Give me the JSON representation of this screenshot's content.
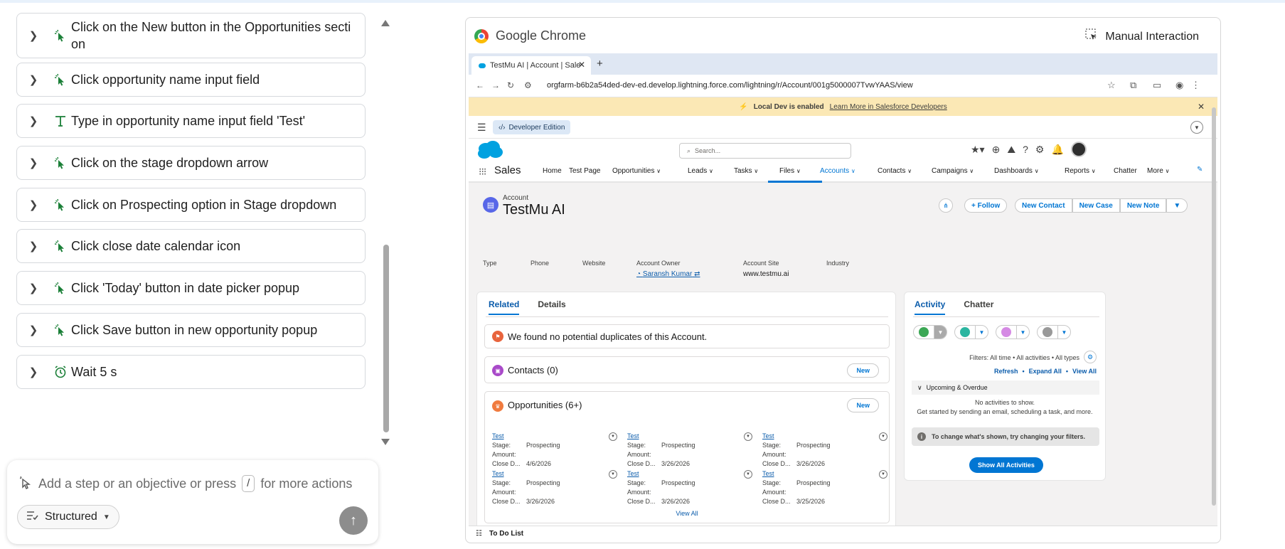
{
  "steps": [
    {
      "icon": "cursor-sparkle-icon",
      "label": "Click on the New button in the Opportunities secti\non"
    },
    {
      "icon": "cursor-sparkle-icon",
      "label": "Click opportunity name input field"
    },
    {
      "icon": "text-type-icon",
      "label": "Type in opportunity name input field 'Test'"
    },
    {
      "icon": "cursor-sparkle-icon",
      "label": "Click on the stage dropdown arrow"
    },
    {
      "icon": "cursor-sparkle-icon",
      "label": "Click on Prospecting option in Stage dropdown"
    },
    {
      "icon": "cursor-sparkle-icon",
      "label": "Click close date calendar icon"
    },
    {
      "icon": "cursor-sparkle-icon",
      "label": "Click 'Today' button in date picker popup"
    },
    {
      "icon": "cursor-sparkle-icon",
      "label": "Click Save button in new opportunity popup"
    },
    {
      "icon": "alarm-clock-icon",
      "label": "Wait 5 s"
    }
  ],
  "composer": {
    "placeholder_pre": "Add a step or an objective or press",
    "kbd": "/",
    "placeholder_post": "for more actions",
    "mode": "Structured"
  },
  "browser": {
    "app": "Google Chrome",
    "manual": "Manual Interaction",
    "tab_title": "TestMu AI | Account | Sale",
    "url": "orgfarm-b6b2a54ded-dev-ed.develop.lightning.force.com/lightning/r/Account/001g5000007TvwYAAS/view"
  },
  "sf": {
    "banner_text": "Local Dev is enabled",
    "banner_link": "Learn More in Salesforce Developers",
    "edition": "Developer Edition",
    "search_placeholder": "Search...",
    "app_name": "Sales",
    "nav": [
      "Home",
      "Test Page",
      "Opportunities",
      "Leads",
      "Tasks",
      "Files",
      "Accounts",
      "Contacts",
      "Campaigns",
      "Dashboards",
      "Reports",
      "Chatter",
      "More"
    ],
    "record_type": "Account",
    "record_name": "TestMu AI",
    "buttons": {
      "follow": "Follow",
      "new_contact": "New Contact",
      "new_case": "New Case",
      "new_note": "New Note"
    },
    "fields": {
      "type": "Type",
      "phone": "Phone",
      "website": "Website",
      "owner_label": "Account Owner",
      "owner_value": "Saransh Kumar",
      "site_label": "Account Site",
      "site_value": "www.testmu.ai",
      "industry": "Industry"
    },
    "tabs": {
      "related": "Related",
      "details": "Details"
    },
    "duplicates": "We found no potential duplicates of this Account.",
    "contacts_title": "Contacts (0)",
    "opps_title": "Opportunities (6+)",
    "new_label": "New",
    "opp_keys": {
      "stage": "Stage:",
      "amount": "Amount:",
      "close": "Close D..."
    },
    "opportunities": [
      {
        "name": "Test",
        "stage": "Prospecting",
        "amount": "",
        "close": "4/6/2026"
      },
      {
        "name": "Test",
        "stage": "Prospecting",
        "amount": "",
        "close": "3/26/2026"
      },
      {
        "name": "Test",
        "stage": "Prospecting",
        "amount": "",
        "close": "3/26/2026"
      },
      {
        "name": "Test",
        "stage": "Prospecting",
        "amount": "",
        "close": "3/26/2026"
      },
      {
        "name": "Test",
        "stage": "Prospecting",
        "amount": "",
        "close": "3/26/2026"
      },
      {
        "name": "Test",
        "stage": "Prospecting",
        "amount": "",
        "close": "3/25/2026"
      }
    ],
    "view_all": "View All",
    "activity": {
      "tab_activity": "Activity",
      "tab_chatter": "Chatter",
      "filters": "Filters: All time • All activities • All types",
      "refresh": "Refresh",
      "expand": "Expand All",
      "view_all": "View All",
      "upcoming": "Upcoming & Overdue",
      "no_act": "No activities to show.",
      "get_started": "Get started by sending an email, scheduling a task, and more.",
      "tip": "To change what's shown, try changing your filters.",
      "show_all": "Show All Activities"
    },
    "todo": "To Do List"
  },
  "colors": {
    "accent": "#0176d3",
    "step_icon": "#1a7f37",
    "banner": "#fbe8b5"
  }
}
